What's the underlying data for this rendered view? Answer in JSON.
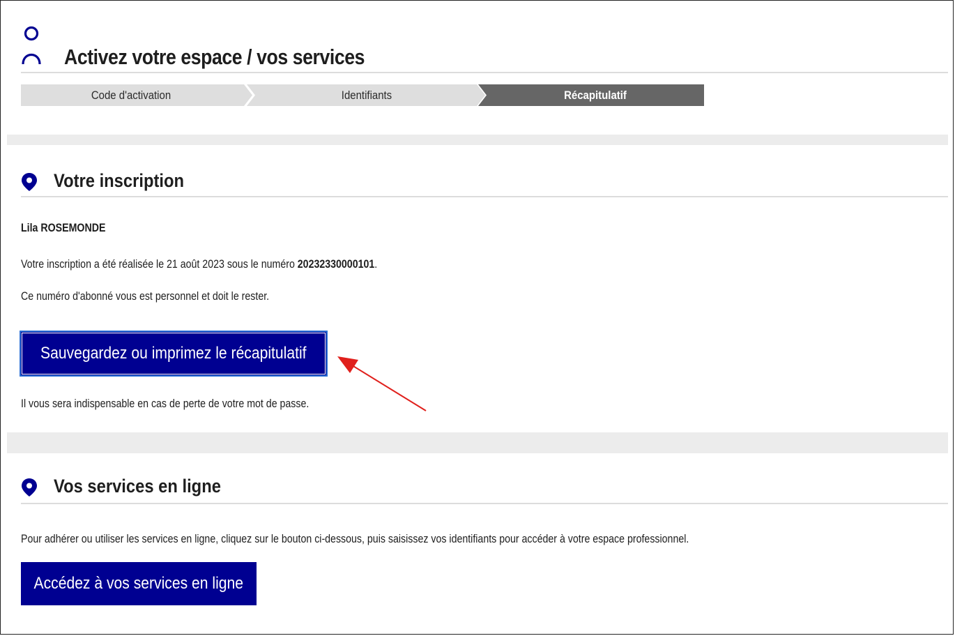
{
  "header": {
    "title": "Activez votre espace / vos services",
    "icon": "user-icon"
  },
  "stepper": {
    "steps": [
      {
        "label": "Code d'activation",
        "state": "inactive"
      },
      {
        "label": "Identifiants",
        "state": "inactive"
      },
      {
        "label": "Récapitulatif",
        "state": "active"
      }
    ],
    "colors": {
      "inactive": "#dedede",
      "active": "#666666"
    }
  },
  "inscription": {
    "title": "Votre inscription",
    "icon": "map-pin-icon",
    "name": "Lila ROSEMONDE",
    "line1_prefix": "Votre inscription a été réalisée le 21 août 2023 sous le numéro ",
    "subscriber_number": "20232330000101",
    "line1_suffix": ".",
    "line2": "Ce numéro d'abonné vous est personnel et doit le rester.",
    "save_button": "Sauvegardez ou imprimez le récapitulatif",
    "note": "Il vous sera indispensable en cas de perte de votre mot de passe."
  },
  "services": {
    "title": "Vos services en ligne",
    "icon": "map-pin-icon",
    "description": "Pour adhérer ou utiliser les services en ligne, cliquez sur le bouton ci-dessous, puis saisissez vos identifiants pour accéder à votre espace professionnel.",
    "access_button": "Accédez à vos services en ligne"
  },
  "annotation": {
    "icon": "red-arrow-icon",
    "color": "#e0201c"
  },
  "colors": {
    "brand": "#000091",
    "text": "#1e1e1e",
    "separator": "#ececec"
  }
}
